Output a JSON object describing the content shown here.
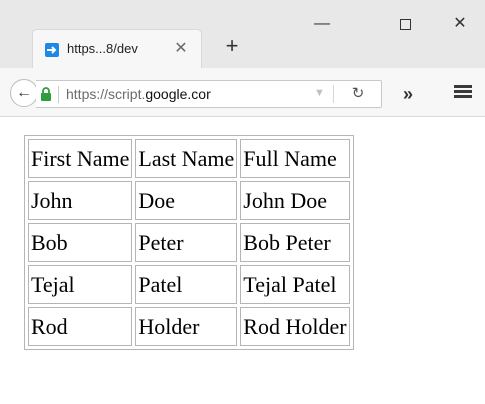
{
  "browser": {
    "tab": {
      "title": "https...8/dev",
      "close_glyph": "✕"
    },
    "new_tab_glyph": "+",
    "window_controls": {
      "minimize_glyph": "—",
      "close_glyph": "✕"
    },
    "address_bar": {
      "prefix": "https://script.",
      "host": "google.cor",
      "dropdown_glyph": "▼",
      "reload_glyph": "↻"
    },
    "overflow_glyph": "»",
    "back_glyph": "←",
    "icons": [
      "favicon-icon",
      "close-icon",
      "plus-icon",
      "minimize-icon",
      "maximize-icon",
      "back-arrow-icon",
      "lock-icon",
      "dropdown-icon",
      "reload-icon",
      "overflow-icon",
      "hamburger-menu-icon"
    ]
  },
  "colors": {
    "accent_favicon": "#1e88e5",
    "lock_green": "#2e9d3b"
  },
  "table": {
    "headers": [
      "First Name",
      "Last Name",
      "Full Name"
    ],
    "rows": [
      [
        "John",
        "Doe",
        "John Doe"
      ],
      [
        "Bob",
        "Peter",
        "Bob Peter"
      ],
      [
        "Tejal",
        "Patel",
        "Tejal Patel"
      ],
      [
        "Rod",
        "Holder",
        "Rod Holder"
      ]
    ]
  }
}
